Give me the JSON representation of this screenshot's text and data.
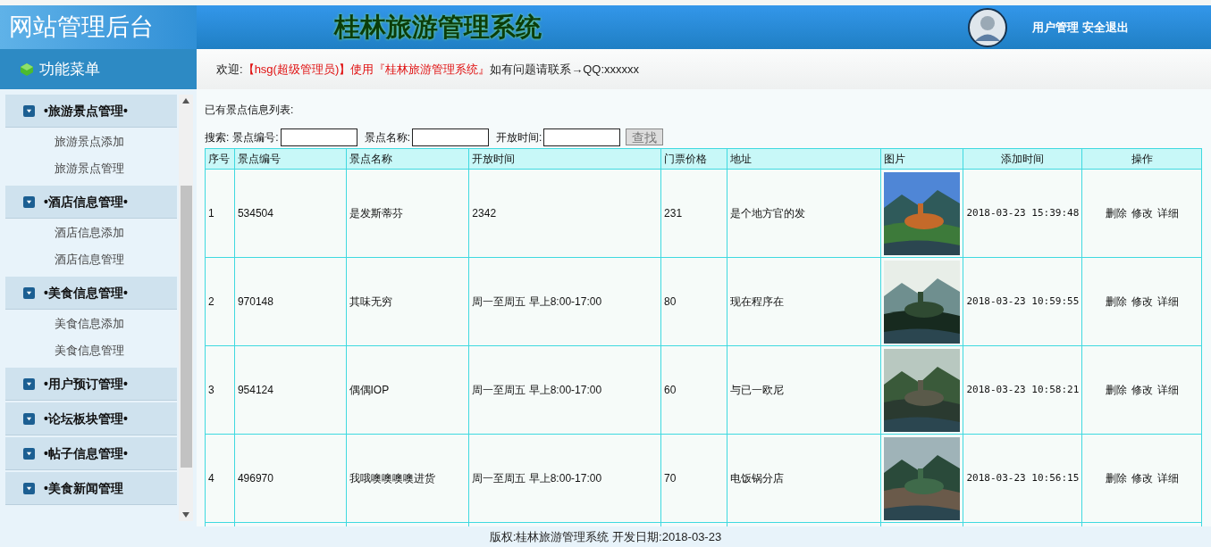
{
  "header": {
    "brand": "网站管理后台",
    "title": "桂林旅游管理系统",
    "links": [
      "用户管理",
      "安全退出"
    ]
  },
  "sidebar": {
    "title": "功能菜单",
    "groups": [
      {
        "label": "•旅游景点管理•",
        "items": [
          "旅游景点添加",
          "旅游景点管理"
        ]
      },
      {
        "label": "•酒店信息管理•",
        "items": [
          "酒店信息添加",
          "酒店信息管理"
        ]
      },
      {
        "label": "•美食信息管理•",
        "items": [
          "美食信息添加",
          "美食信息管理"
        ]
      },
      {
        "label": "•用户预订管理•"
      },
      {
        "label": "•论坛板块管理•"
      },
      {
        "label": "•帖子信息管理•"
      },
      {
        "label": "•美食新闻管理"
      }
    ]
  },
  "welcome": {
    "prefix": "欢迎:",
    "highlight": "【hsg(超级管理员)】使用『桂林旅游管理系统』",
    "suffix": "如有问题请联系→QQ:xxxxxx"
  },
  "content": {
    "heading": "已有景点信息列表:",
    "search": {
      "label": "搜索:",
      "fields": [
        "景点编号:",
        "景点名称:",
        "开放时间:"
      ],
      "button": "查找"
    },
    "table": {
      "columns": [
        "序号",
        "景点编号",
        "景点名称",
        "开放时间",
        "门票价格",
        "地址",
        "图片",
        "添加时间",
        "操作"
      ],
      "rows": [
        {
          "cells": [
            "1",
            "534504",
            "是发斯蒂芬",
            "2342",
            "231",
            "是个地方官的发"
          ],
          "picture": {
            "kind": "picture"
          },
          "added": "2018-03-23 15:39:48",
          "actions": [
            "删除",
            "修改",
            "详细"
          ]
        },
        {
          "cells": [
            "2",
            "970148",
            "其味无穷",
            "周一至周五 早上8:00-17:00",
            "80",
            "现在程序在"
          ],
          "picture": {
            "kind": "picture"
          },
          "added": "2018-03-23 10:59:55",
          "actions": [
            "删除",
            "修改",
            "详细"
          ]
        },
        {
          "cells": [
            "3",
            "954124",
            "偶偶IOP",
            "周一至周五 早上8:00-17:00",
            "60",
            "与已一欧尼"
          ],
          "picture": {
            "kind": "picture"
          },
          "added": "2018-03-23 10:58:21",
          "actions": [
            "删除",
            "修改",
            "详细"
          ]
        },
        {
          "cells": [
            "4",
            "496970",
            "我哦噢噢噢噢进货",
            "周一至周五 早上8:00-17:00",
            "70",
            "电饭锅分店"
          ],
          "picture": {
            "kind": "picture"
          },
          "added": "2018-03-23 10:56:15",
          "actions": [
            "删除",
            "修改",
            "详细"
          ]
        }
      ]
    }
  },
  "footer": "版权:桂林旅游管理系统 开发日期:2018-03-23"
}
